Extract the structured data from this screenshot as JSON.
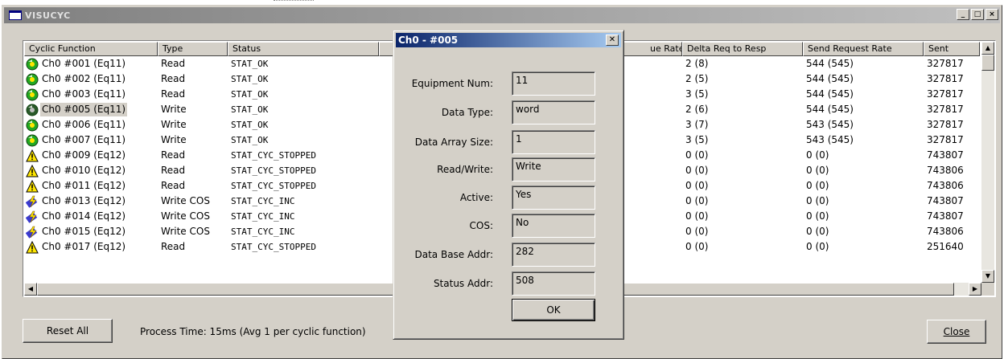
{
  "window": {
    "title": "VISUCYC"
  },
  "columns": [
    "Cyclic Function",
    "Type",
    "Status",
    "",
    "ue Rate",
    "Delta Req to Resp",
    "Send Request Rate",
    "Sent"
  ],
  "rows": [
    {
      "icon": "ok",
      "fn": "Ch0 #001 (Eq11)",
      "type": "Read",
      "status": "STAT_OK",
      "delta": "2 (8)",
      "send": "544 (545)",
      "sent": "327817"
    },
    {
      "icon": "ok",
      "fn": "Ch0 #002 (Eq11)",
      "type": "Read",
      "status": "STAT_OK",
      "delta": "2 (5)",
      "send": "544 (545)",
      "sent": "327817"
    },
    {
      "icon": "ok",
      "fn": "Ch0 #003 (Eq11)",
      "type": "Read",
      "status": "STAT_OK",
      "delta": "3 (5)",
      "send": "544 (545)",
      "sent": "327817"
    },
    {
      "icon": "ok-dark",
      "fn": "Ch0 #005 (Eq11)",
      "type": "Write",
      "status": "STAT_OK",
      "delta": "2 (6)",
      "send": "544 (545)",
      "sent": "327817",
      "selected": true
    },
    {
      "icon": "ok",
      "fn": "Ch0 #006 (Eq11)",
      "type": "Write",
      "status": "STAT_OK",
      "delta": "3 (7)",
      "send": "543 (545)",
      "sent": "327817"
    },
    {
      "icon": "ok",
      "fn": "Ch0 #007 (Eq11)",
      "type": "Write",
      "status": "STAT_OK",
      "delta": "3 (5)",
      "send": "543 (545)",
      "sent": "327817"
    },
    {
      "icon": "warning",
      "fn": "Ch0 #009 (Eq12)",
      "type": "Read",
      "status": "STAT_CYC_STOPPED",
      "delta": "0 (0)",
      "send": "0 (0)",
      "sent": "743807"
    },
    {
      "icon": "warning",
      "fn": "Ch0 #010 (Eq12)",
      "type": "Read",
      "status": "STAT_CYC_STOPPED",
      "delta": "0 (0)",
      "send": "0 (0)",
      "sent": "743806"
    },
    {
      "icon": "warning",
      "fn": "Ch0 #011 (Eq12)",
      "type": "Read",
      "status": "STAT_CYC_STOPPED",
      "delta": "0 (0)",
      "send": "0 (0)",
      "sent": "743806"
    },
    {
      "icon": "cos",
      "fn": "Ch0 #013 (Eq12)",
      "type": "Write COS",
      "status": "STAT_CYC_INC",
      "delta": "0 (0)",
      "send": "0 (0)",
      "sent": "743807"
    },
    {
      "icon": "cos",
      "fn": "Ch0 #014 (Eq12)",
      "type": "Write COS",
      "status": "STAT_CYC_INC",
      "delta": "0 (0)",
      "send": "0 (0)",
      "sent": "743807"
    },
    {
      "icon": "cos",
      "fn": "Ch0 #015 (Eq12)",
      "type": "Write COS",
      "status": "STAT_CYC_INC",
      "delta": "0 (0)",
      "send": "0 (0)",
      "sent": "743806"
    },
    {
      "icon": "warning",
      "fn": "Ch0 #017 (Eq12)",
      "type": "Read",
      "status": "STAT_CYC_STOPPED",
      "delta": "0 (0)",
      "send": "0 (0)",
      "sent": "251640"
    }
  ],
  "footer": {
    "reset_label": "Reset All",
    "process_time": "Process Time: 15ms (Avg 1 per cyclic function)",
    "close_label": "Close"
  },
  "dialog": {
    "title": "Ch0 - #005",
    "fields": [
      {
        "label": "Equipment Num:",
        "value": "11"
      },
      {
        "label": "Data Type:",
        "value": "word"
      },
      {
        "label": "Data Array Size:",
        "value": "1"
      },
      {
        "label": "Read/Write:",
        "value": "Write"
      },
      {
        "label": "Active:",
        "value": "Yes"
      },
      {
        "label": "COS:",
        "value": "No"
      },
      {
        "label": "Data Base Addr:",
        "value": "282"
      },
      {
        "label": "Status Addr:",
        "value": "508"
      }
    ],
    "ok_label": "OK"
  },
  "colors": {
    "ok_green": "#22a822",
    "warn_yellow": "#ffe600",
    "cos_blue": "#3a3acf",
    "selection": "#d4d0c8"
  }
}
